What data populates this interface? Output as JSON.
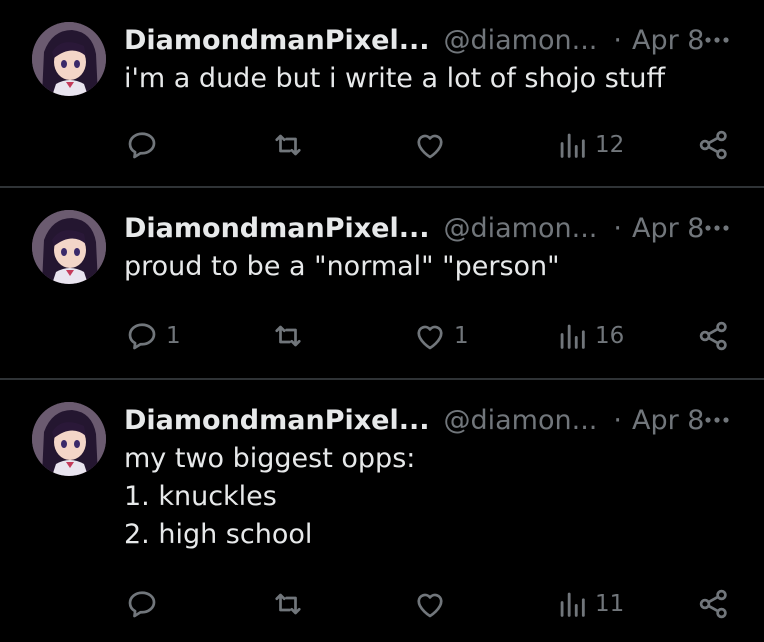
{
  "tweets": [
    {
      "author_name": "DiamondmanPixel...",
      "handle": "@diamon...",
      "separator": "·",
      "date": "Apr 8",
      "text": "i'm a dude but i write a lot of shojo stuff",
      "reply_count": "",
      "retweet_count": "",
      "like_count": "",
      "view_count": "12"
    },
    {
      "author_name": "DiamondmanPixel...",
      "handle": "@diamon...",
      "separator": "·",
      "date": "Apr 8",
      "text": "proud to be a \"normal\" \"person\"",
      "reply_count": "1",
      "retweet_count": "",
      "like_count": "1",
      "view_count": "16"
    },
    {
      "author_name": "DiamondmanPixel...",
      "handle": "@diamon...",
      "separator": "·",
      "date": "Apr 8",
      "text": "my two biggest opps:\n1. knuckles\n2. high school",
      "reply_count": "",
      "retweet_count": "",
      "like_count": "",
      "view_count": "11"
    }
  ],
  "icons": {
    "reply": "reply-icon",
    "retweet": "retweet-icon",
    "like": "heart-icon",
    "views": "views-chart-icon",
    "share": "share-icon",
    "more": "more-dots-icon"
  },
  "colors": {
    "background": "#000000",
    "text_primary": "#e7e9ea",
    "text_secondary": "#71767b",
    "divider": "#2f3336"
  }
}
